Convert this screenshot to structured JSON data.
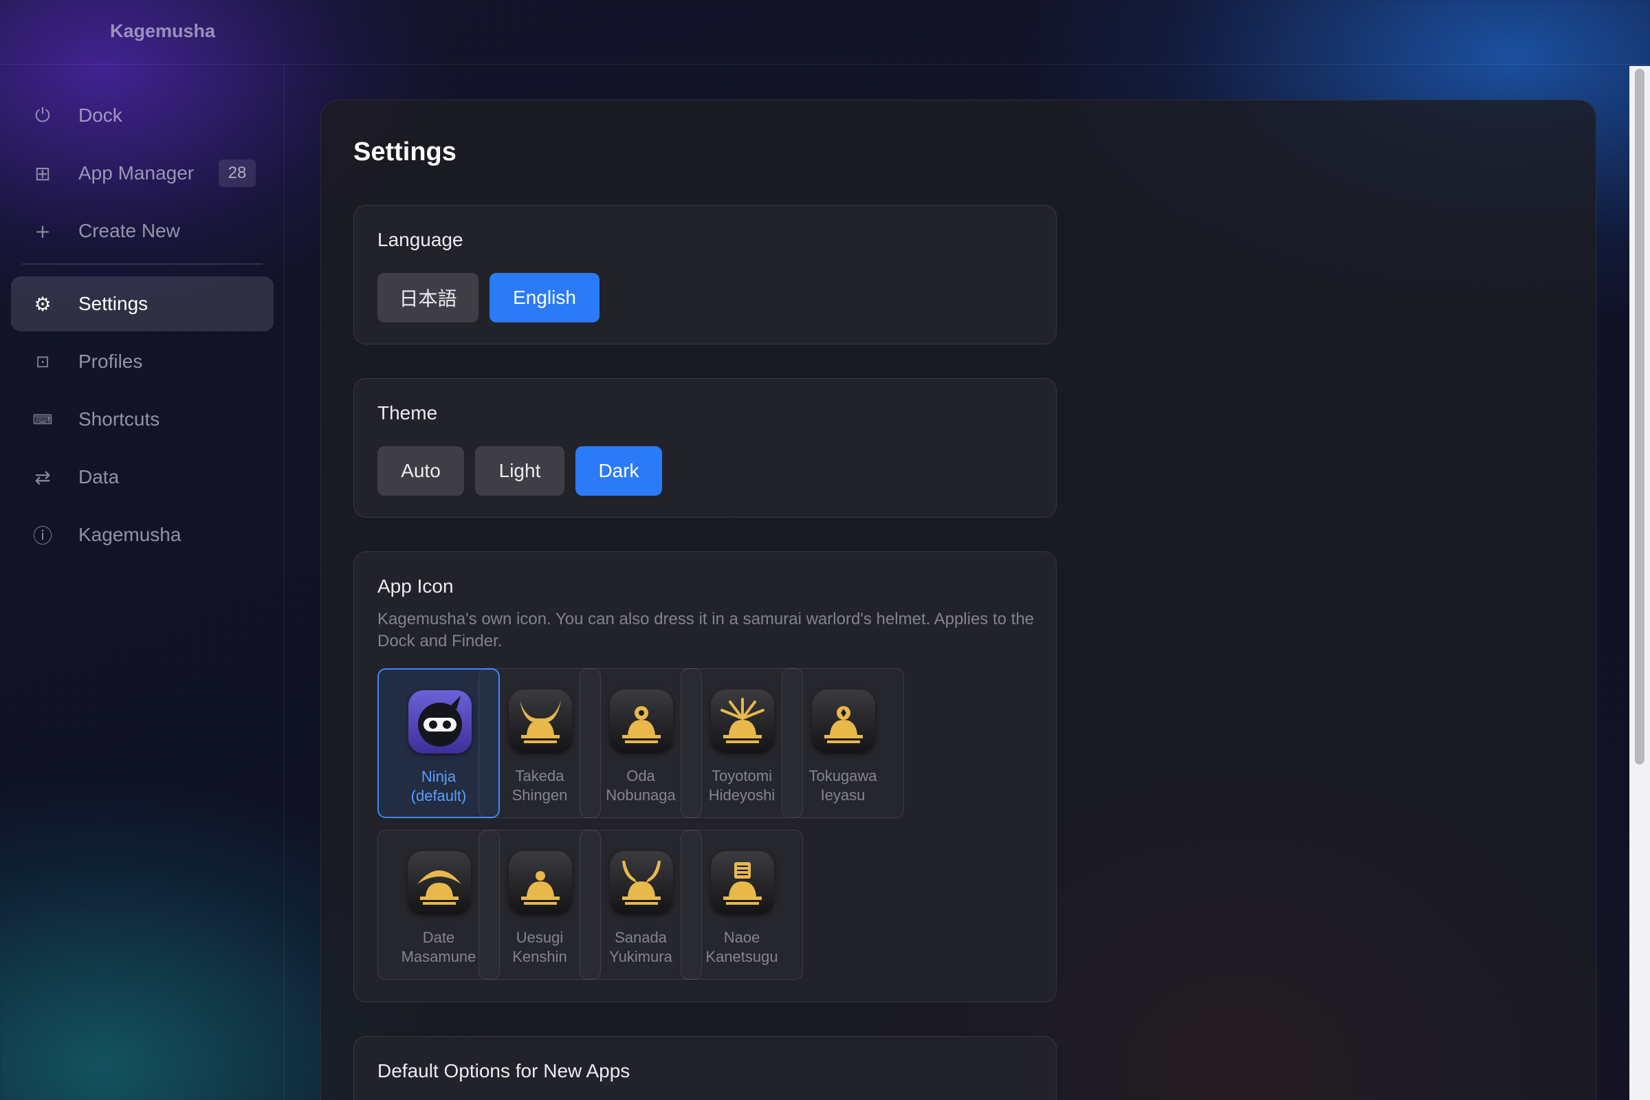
{
  "app": {
    "title": "Kagemusha"
  },
  "sidebar": {
    "items": [
      {
        "label": "Dock",
        "icon": "power-icon"
      },
      {
        "label": "App Manager",
        "icon": "grid-icon",
        "badge": "28"
      },
      {
        "label": "Create New",
        "icon": "plus-icon"
      },
      {
        "label": "Settings",
        "icon": "gear-icon",
        "active": true
      },
      {
        "label": "Profiles",
        "icon": "profile-icon"
      },
      {
        "label": "Shortcuts",
        "icon": "keyboard-icon"
      },
      {
        "label": "Data",
        "icon": "transfer-arrows-icon"
      },
      {
        "label": "Kagemusha",
        "icon": "info-icon"
      }
    ]
  },
  "main": {
    "title": "Settings",
    "language": {
      "title": "Language",
      "options": [
        "日本語",
        "English"
      ],
      "selected": "English"
    },
    "theme": {
      "title": "Theme",
      "options": [
        "Auto",
        "Light",
        "Dark"
      ],
      "selected": "Dark"
    },
    "app_icon": {
      "title": "App Icon",
      "description": "Kagemusha's own icon. You can also dress it in a samurai warlord's helmet. Applies to the Dock and Finder.",
      "icons": [
        {
          "line1": "Ninja",
          "line2": "(default)",
          "selected": true
        },
        {
          "line1": "Takeda",
          "line2": "Shingen"
        },
        {
          "line1": "Oda",
          "line2": "Nobunaga"
        },
        {
          "line1": "Toyotomi",
          "line2": "Hideyoshi"
        },
        {
          "line1": "Tokugawa",
          "line2": "Ieyasu"
        },
        {
          "line1": "Date",
          "line2": "Masamune"
        },
        {
          "line1": "Uesugi",
          "line2": "Kenshin"
        },
        {
          "line1": "Sanada",
          "line2": "Yukimura"
        },
        {
          "line1": "Naoe",
          "line2": "Kanetsugu"
        }
      ]
    },
    "defaults": {
      "title": "Default Options for New Apps"
    }
  },
  "colors": {
    "accent": "#2b7bf8",
    "helmet_gold": "#e8b84a",
    "ninja_purple": "#5a4fd0"
  }
}
